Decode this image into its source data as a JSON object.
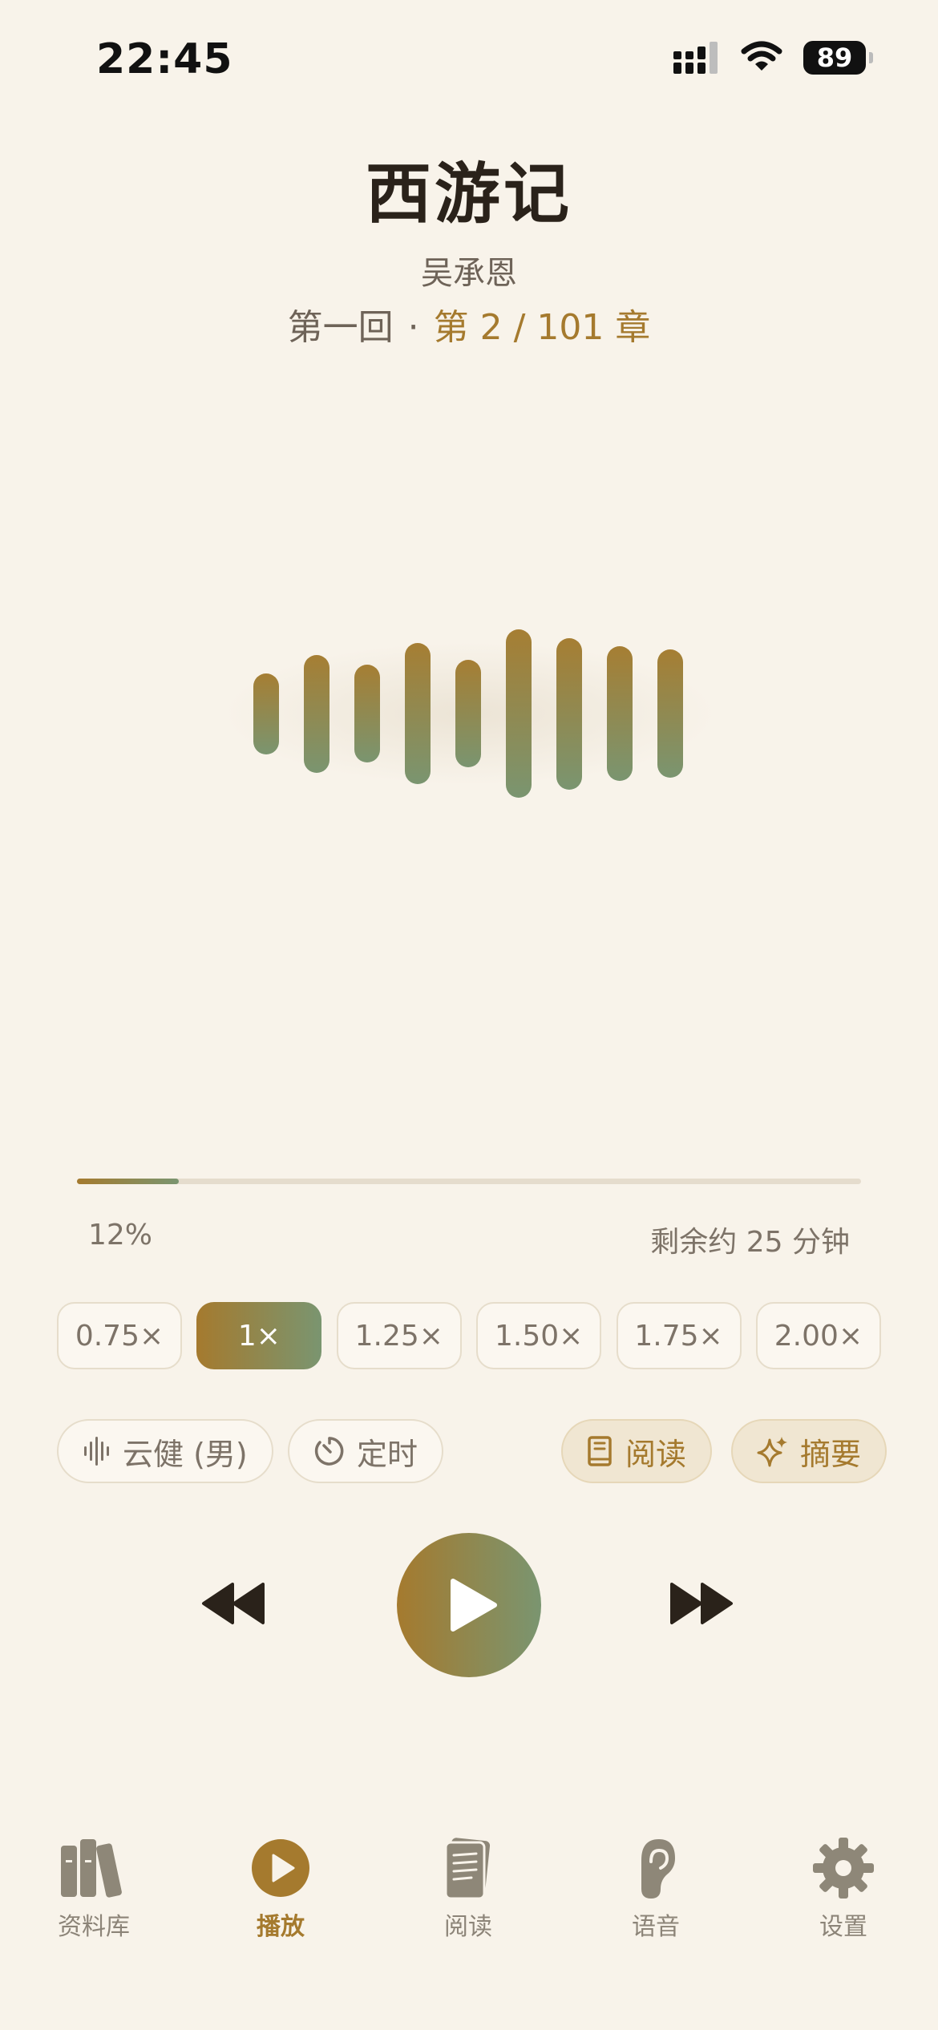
{
  "status": {
    "time": "22:45",
    "battery": "89"
  },
  "book": {
    "title": "西游记",
    "author": "吴承恩",
    "chapter_name": "第一回",
    "separator": "·",
    "chapter_progress": "第 2 / 101 章"
  },
  "waveform": {
    "bar_levels": [
      0.48,
      0.7,
      0.58,
      0.84,
      0.64,
      1.0,
      0.9,
      0.8,
      0.76
    ]
  },
  "progress": {
    "fraction": 0.13,
    "percent_label": "12%",
    "remaining_label": "剩余约 25 分钟"
  },
  "speeds": {
    "options": [
      "0.75×",
      "1×",
      "1.25×",
      "1.50×",
      "1.75×",
      "2.00×"
    ],
    "selected": "1×"
  },
  "chips": {
    "voice": "云健 (男)",
    "timer": "定时",
    "read": "阅读",
    "summary": "摘要"
  },
  "tabs": [
    {
      "label": "资料库",
      "icon": "library-icon"
    },
    {
      "label": "播放",
      "icon": "play-circle-icon",
      "active": true
    },
    {
      "label": "阅读",
      "icon": "document-icon"
    },
    {
      "label": "语音",
      "icon": "ear-icon"
    },
    {
      "label": "设置",
      "icon": "gear-icon"
    }
  ],
  "colors": {
    "background": "#F8F3EA",
    "accent_gold": "#A57A2E",
    "accent_green": "#7A9570",
    "text_dark": "#2A221A",
    "text_muted": "#7D7368"
  }
}
